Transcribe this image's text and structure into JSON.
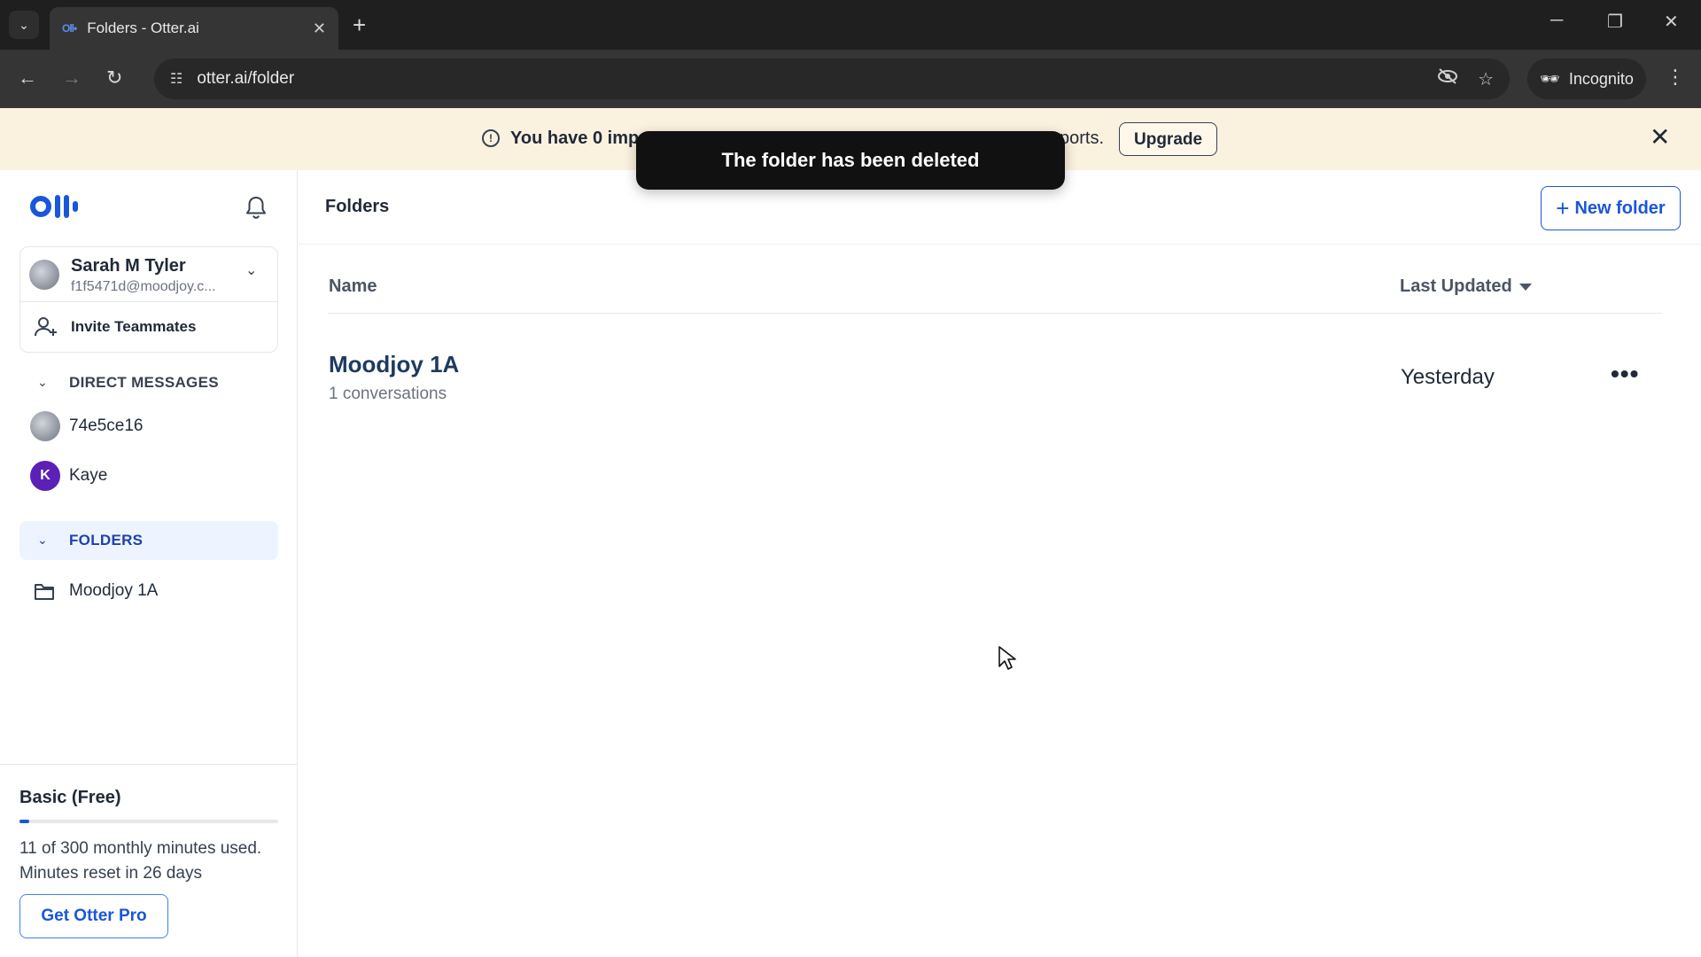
{
  "browser": {
    "tab_title": "Folders - Otter.ai",
    "tab_favicon": "Oll•",
    "url": "otter.ai/folder",
    "incognito_label": "Incognito",
    "icons": [
      "tab-search-icon",
      "close-icon",
      "new-tab-icon",
      "minimize-icon",
      "restore-icon",
      "window-close-icon",
      "back-icon",
      "forward-icon",
      "reload-icon",
      "site-settings-icon",
      "eye-off-icon",
      "star-icon",
      "incognito-icon",
      "kebab-menu-icon"
    ]
  },
  "banner": {
    "text_start": "You have 0 imp",
    "text_end": "ports.",
    "upgrade_label": "Upgrade",
    "background": "#fbf1df"
  },
  "toast": {
    "message": "The folder has been deleted"
  },
  "sidebar": {
    "user": {
      "name": "Sarah M Tyler",
      "email": "f1f5471d@moodjoy.c..."
    },
    "invite_label": "Invite Teammates",
    "direct_messages": {
      "heading": "DIRECT MESSAGES",
      "items": [
        {
          "label": "74e5ce16",
          "avatar": "photo"
        },
        {
          "label": "Kaye",
          "avatar_letter": "K"
        }
      ]
    },
    "folders": {
      "heading": "FOLDERS",
      "items": [
        {
          "label": "Moodjoy 1A"
        }
      ]
    },
    "plan": {
      "name": "Basic (Free)",
      "usage_line_1": "11 of 300 monthly minutes used.",
      "usage_line_2": "Minutes reset in 26 days",
      "used_minutes": 11,
      "total_minutes": 300,
      "cta_label": "Get Otter Pro"
    }
  },
  "main": {
    "title": "Folders",
    "new_folder_label": "New folder",
    "columns": {
      "name": "Name",
      "last_updated": "Last Updated"
    },
    "rows": [
      {
        "title": "Moodjoy 1A",
        "subtitle": "1 conversations",
        "updated": "Yesterday"
      }
    ]
  },
  "colors": {
    "accent": "#1a56db",
    "toast_bg": "#111111",
    "folder_highlight": "#eef4ff",
    "kaye_avatar": "#5b21b6"
  }
}
